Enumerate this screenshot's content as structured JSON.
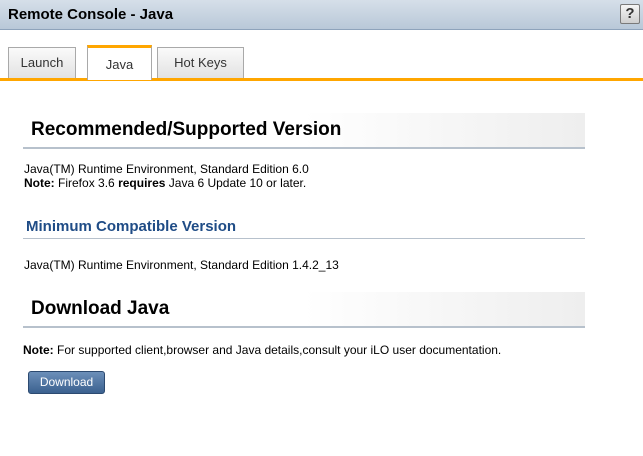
{
  "window": {
    "title": "Remote Console - Java",
    "help_label": "?"
  },
  "tabs": [
    {
      "label": "Launch",
      "active": false
    },
    {
      "label": "Java",
      "active": true
    },
    {
      "label": "Hot Keys",
      "active": false
    }
  ],
  "recommended": {
    "heading": "Recommended/Supported Version",
    "line1": "Java(TM) Runtime Environment, Standard Edition 6.0",
    "note_label": "Note:",
    "note_part1": "Firefox 3.6",
    "note_bold": "requires",
    "note_part2": "Java 6 Update 10 or later."
  },
  "minimum": {
    "heading": "Minimum Compatible Version",
    "line1": "Java(TM) Runtime Environment, Standard Edition 1.4.2_13"
  },
  "download": {
    "heading": "Download Java",
    "note_label": "Note:",
    "note_text": "For supported client,browser and Java details,consult your iLO user documentation.",
    "button_label": "Download"
  },
  "colors": {
    "tab_accent": "#ffa600",
    "heading_blue": "#1f4c86",
    "button": "#4a6f9c"
  }
}
